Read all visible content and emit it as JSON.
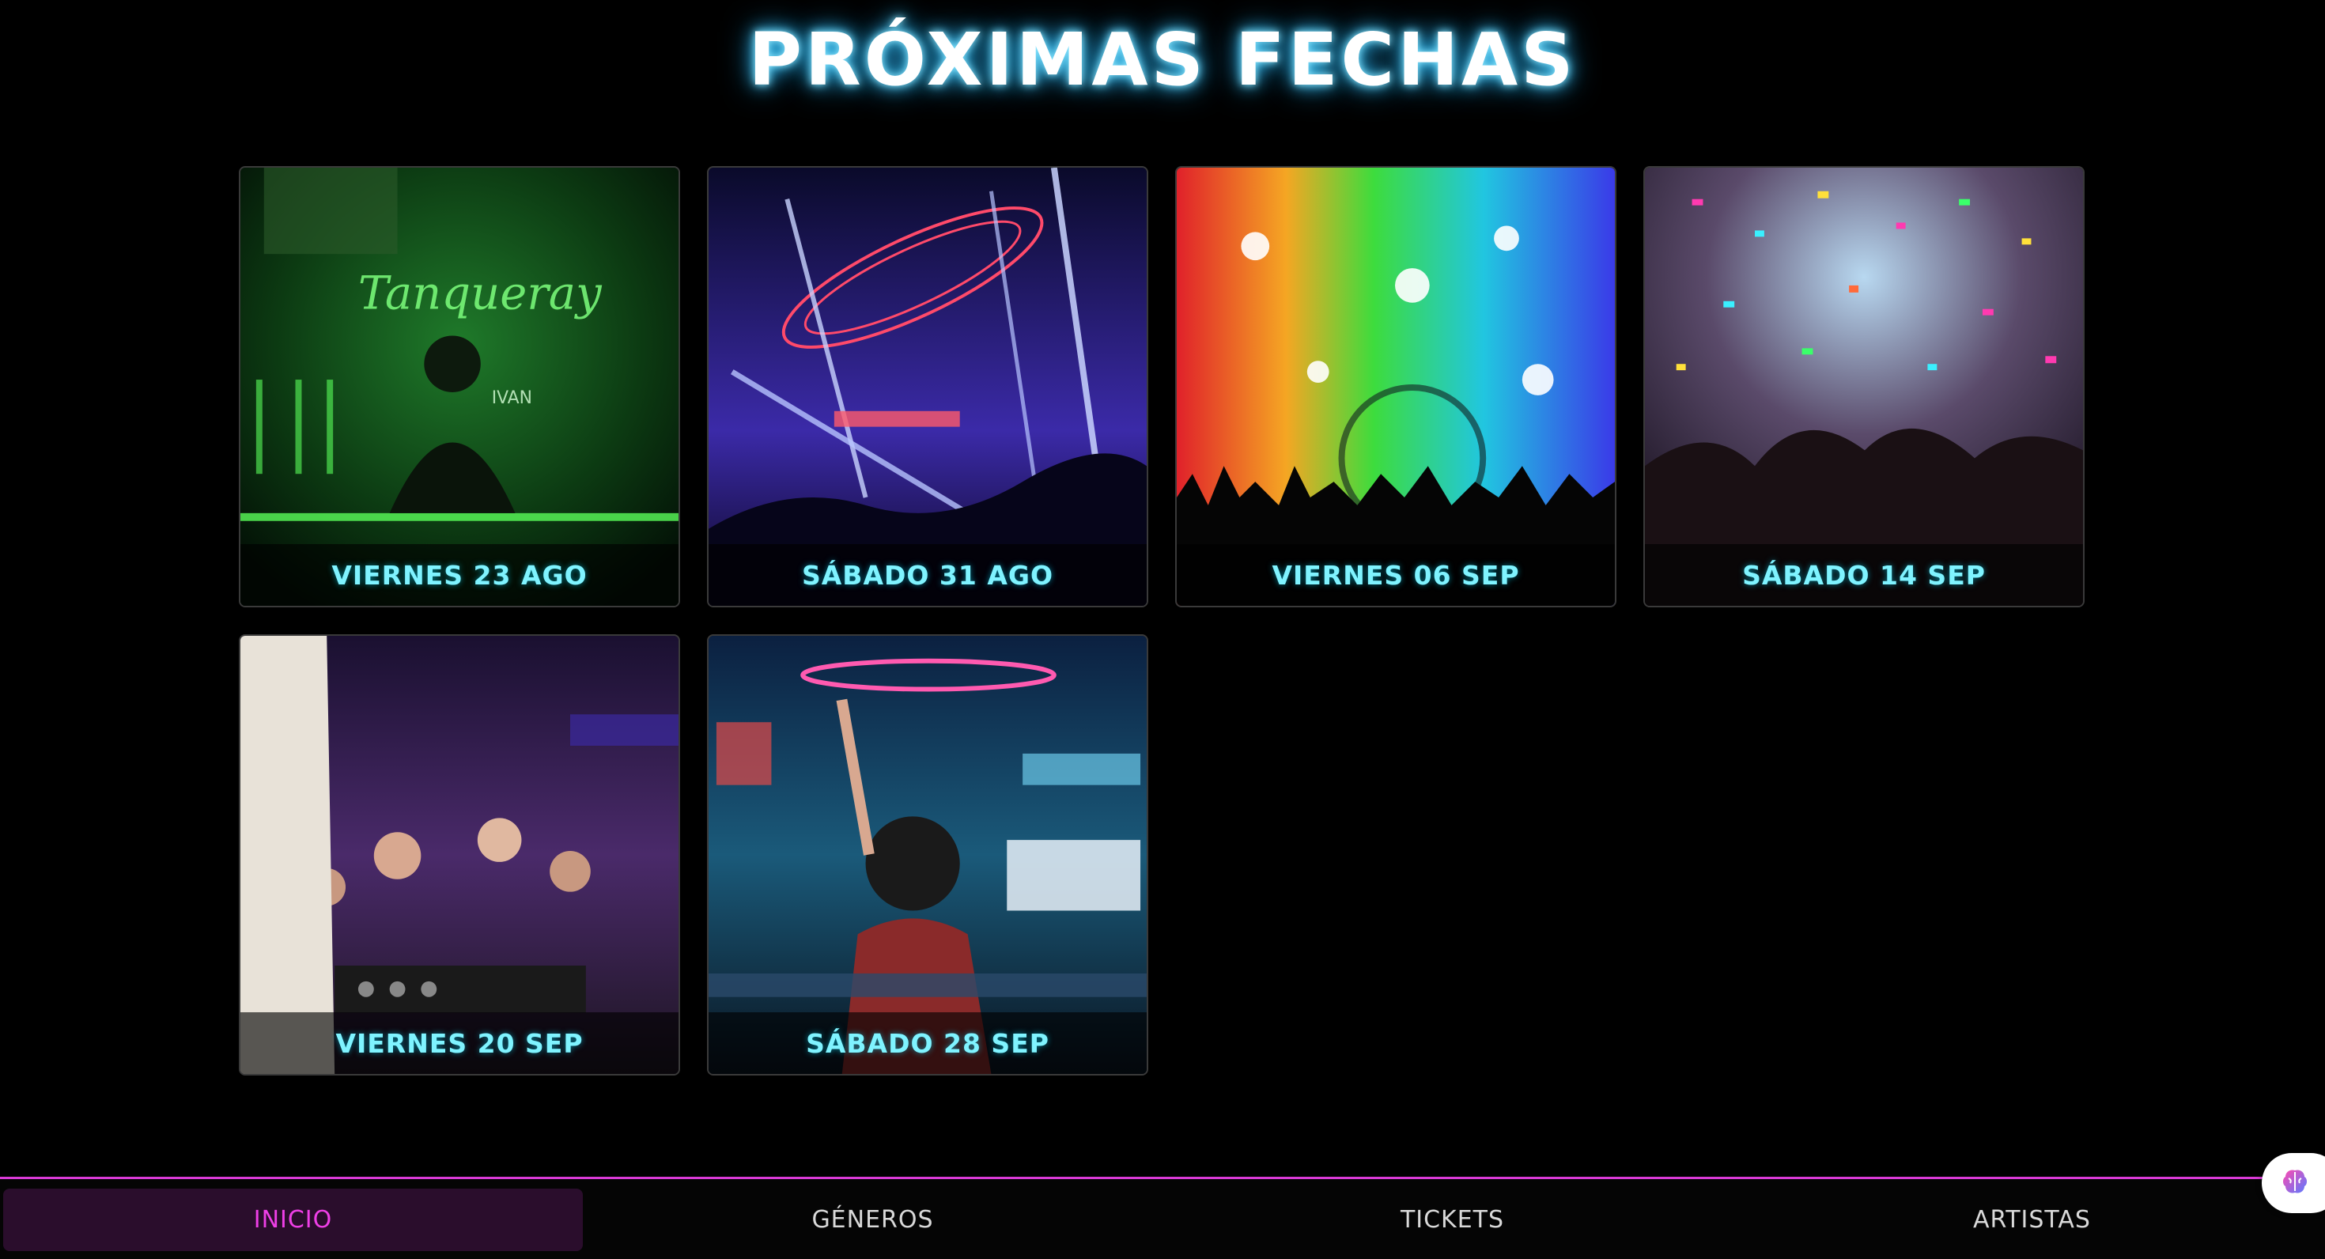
{
  "header": {
    "title": "PRÓXIMAS FECHAS"
  },
  "events": [
    {
      "label": "VIERNES 23 AGO",
      "image": "green-neon-dj-booth"
    },
    {
      "label": "SÁBADO 31 AGO",
      "image": "blue-laser-stage"
    },
    {
      "label": "VIERNES 06 SEP",
      "image": "rainbow-lights-crowd"
    },
    {
      "label": "SÁBADO 14 SEP",
      "image": "confetti-party-crowd"
    },
    {
      "label": "VIERNES 20 SEP",
      "image": "headphone-party-crowd"
    },
    {
      "label": "SÁBADO 28 SEP",
      "image": "dj-with-headphones"
    }
  ],
  "nav": {
    "items": [
      {
        "label": "INICIO",
        "active": true
      },
      {
        "label": "GÉNEROS",
        "active": false
      },
      {
        "label": "TICKETS",
        "active": false
      },
      {
        "label": "ARTISTAS",
        "active": false
      }
    ]
  },
  "colors": {
    "accent": "#d93ad6",
    "label_cyan": "#7ff3ff",
    "background": "#000000"
  },
  "icons": {
    "assistant": "brain-icon"
  }
}
